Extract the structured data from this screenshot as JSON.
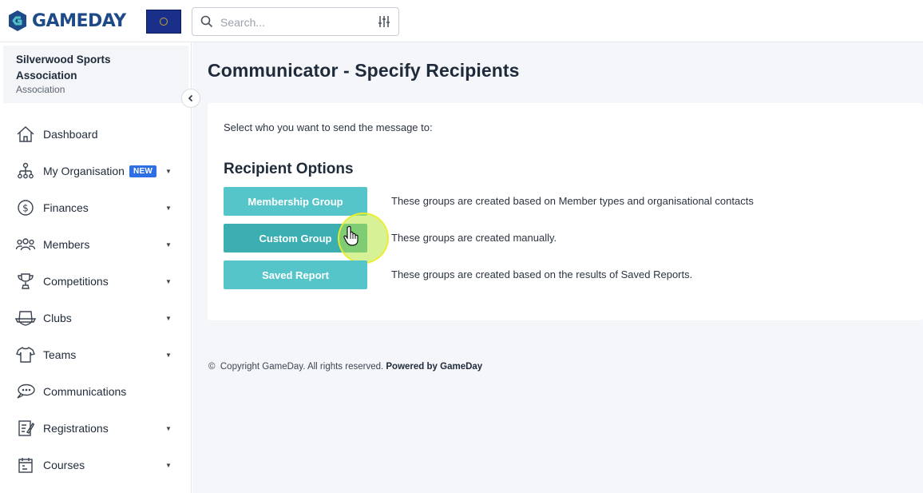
{
  "header": {
    "logo_text": "GAMEDAY",
    "search_placeholder": "Search..."
  },
  "sidebar": {
    "org_name": "Silverwood Sports Association",
    "org_type": "Association",
    "items": [
      {
        "label": "Dashboard",
        "icon": "home-icon",
        "caret": false
      },
      {
        "label": "My Organisation",
        "icon": "org-chart-icon",
        "caret": true,
        "badge": "NEW"
      },
      {
        "label": "Finances",
        "icon": "dollar-icon",
        "caret": true
      },
      {
        "label": "Members",
        "icon": "members-icon",
        "caret": true
      },
      {
        "label": "Competitions",
        "icon": "trophy-icon",
        "caret": true
      },
      {
        "label": "Clubs",
        "icon": "club-icon",
        "caret": true
      },
      {
        "label": "Teams",
        "icon": "jersey-icon",
        "caret": true
      },
      {
        "label": "Communications",
        "icon": "chat-icon",
        "caret": false
      },
      {
        "label": "Registrations",
        "icon": "registration-icon",
        "caret": true
      },
      {
        "label": "Courses",
        "icon": "calendar-icon",
        "caret": true
      }
    ]
  },
  "main": {
    "title": "Communicator - Specify Recipients",
    "instruction": "Select who you want to send the message to:",
    "section_title": "Recipient Options",
    "options": [
      {
        "label": "Membership Group",
        "description": "These groups are created based on Member types and organisational contacts"
      },
      {
        "label": "Custom Group",
        "description": "These groups are created manually."
      },
      {
        "label": "Saved Report",
        "description": "These groups are created based on the results of Saved Reports."
      }
    ],
    "footer_copyright": "Copyright GameDay. All rights reserved.",
    "footer_powered": "Powered by GameDay"
  },
  "colors": {
    "brand": "#1e4b87",
    "button": "#56c5ca",
    "button_active": "#3aaeb1",
    "badge": "#2f6fe4"
  }
}
